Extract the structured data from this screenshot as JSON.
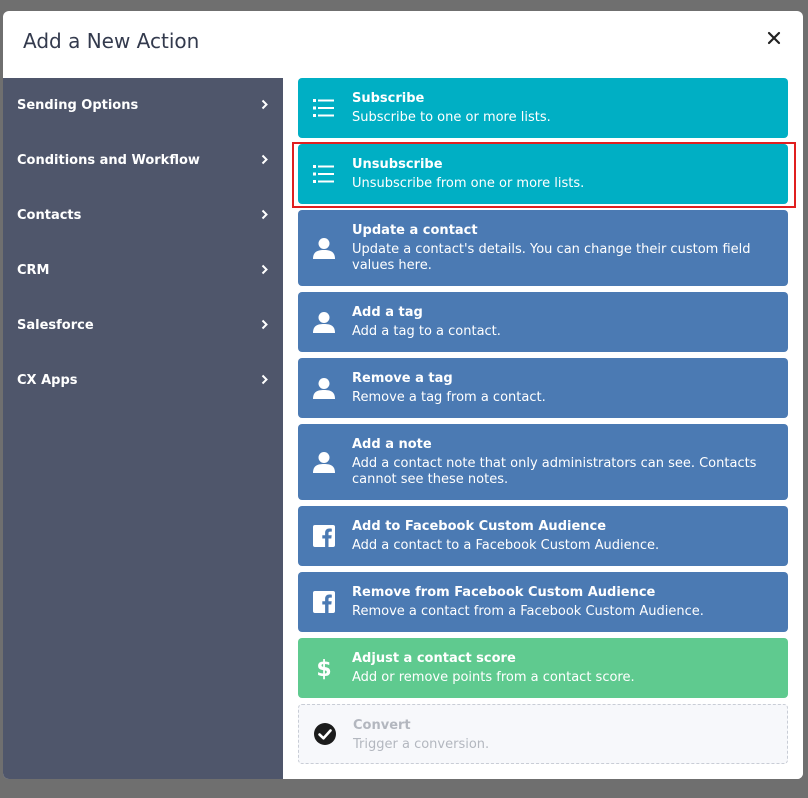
{
  "modal": {
    "title": "Add a New Action",
    "close_glyph": "×"
  },
  "sidebar": {
    "items": [
      {
        "label": "Sending Options"
      },
      {
        "label": "Conditions and Workflow"
      },
      {
        "label": "Contacts"
      },
      {
        "label": "CRM"
      },
      {
        "label": "Salesforce"
      },
      {
        "label": "CX Apps"
      }
    ]
  },
  "actions": [
    {
      "title": "Subscribe",
      "desc": "Subscribe to one or more lists.",
      "icon": "list-icon",
      "color": "#00afc4"
    },
    {
      "title": "Unsubscribe",
      "desc": "Unsubscribe from one or more lists.",
      "icon": "list-icon",
      "color": "#00afc4",
      "highlighted": true
    },
    {
      "title": "Update a contact",
      "desc": "Update a contact's details. You can change their custom field values here.",
      "icon": "person-icon",
      "color": "#4b7ab3"
    },
    {
      "title": "Add a tag",
      "desc": "Add a tag to a contact.",
      "icon": "person-icon",
      "color": "#4b7ab3"
    },
    {
      "title": "Remove a tag",
      "desc": "Remove a tag from a contact.",
      "icon": "person-icon",
      "color": "#4b7ab3"
    },
    {
      "title": "Add a note",
      "desc": "Add a contact note that only administrators can see. Contacts cannot see these notes.",
      "icon": "person-icon",
      "color": "#4b7ab3"
    },
    {
      "title": "Add to Facebook Custom Audience",
      "desc": "Add a contact to a Facebook Custom Audience.",
      "icon": "facebook-icon",
      "color": "#4b7ab3"
    },
    {
      "title": "Remove from Facebook Custom Audience",
      "desc": "Remove a contact from a Facebook Custom Audience.",
      "icon": "facebook-icon",
      "color": "#4b7ab3"
    },
    {
      "title": "Adjust a contact score",
      "desc": "Add or remove points from a contact score.",
      "icon": "dollar-icon",
      "color": "#5fca8f"
    },
    {
      "title": "Convert",
      "desc": "Trigger a conversion.",
      "icon": "checkmark-circle-icon",
      "color": "#f7f8fb",
      "disabled": true
    }
  ],
  "colors": {
    "sidebar_bg": "#4f566b",
    "highlight_border": "#e01f1f",
    "backdrop": "#6f6f6f"
  }
}
